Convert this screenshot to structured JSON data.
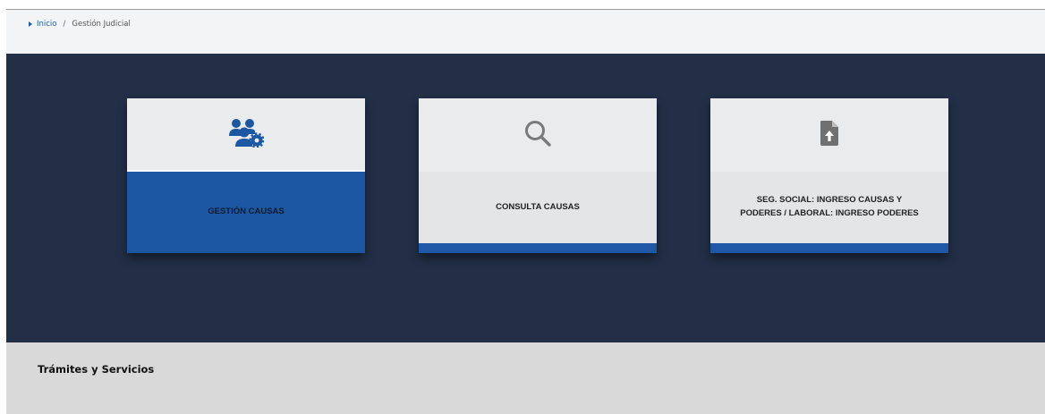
{
  "breadcrumb": {
    "home_label": "Inicio",
    "separator": "/",
    "current_label": "Gestión Judicial"
  },
  "cards": [
    {
      "label": "GESTIÓN CAUSAS",
      "icon": "users-gear-icon",
      "active": true
    },
    {
      "label": "CONSULTA CAUSAS",
      "icon": "search-icon",
      "active": false
    },
    {
      "label": "SEG. SOCIAL: INGRESO CAUSAS Y PODERES / LABORAL: INGRESO PODERES",
      "icon": "file-upload-icon",
      "active": false
    }
  ],
  "footer": {
    "title": "Trámites y Servicios"
  },
  "colors": {
    "hero_background": "#222f47",
    "accent_blue": "#1c57a4",
    "card_background": "#e6e7e9",
    "footer_background": "#d9d9d9"
  }
}
